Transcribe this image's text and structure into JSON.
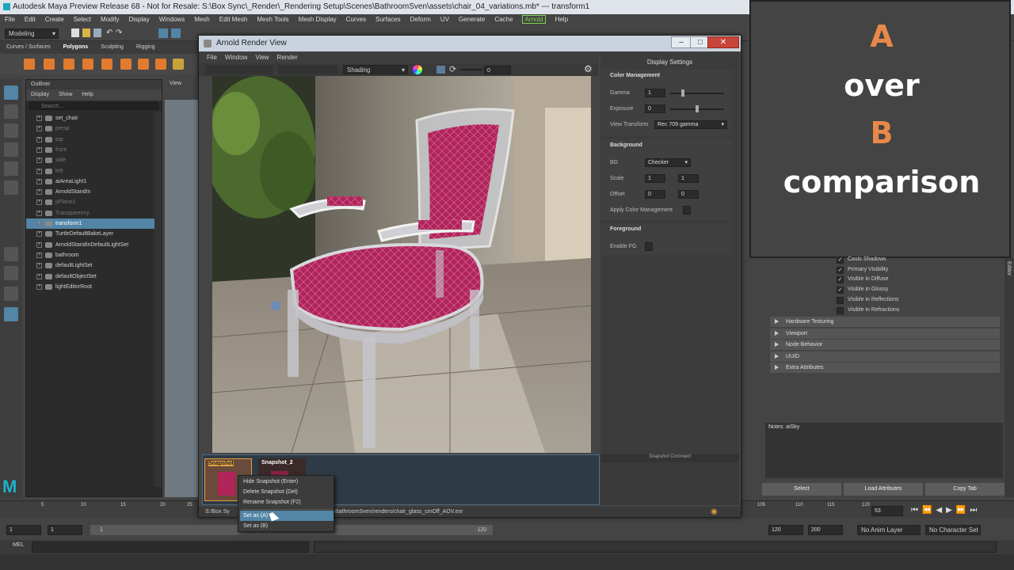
{
  "app": {
    "window_title": "Autodesk Maya Preview Release 68 - Not for Resale: S:\\Box Sync\\_Render\\_Rendering Setup\\Scenes\\BathroomSven\\assets\\chair_04_variations.mb*   ---   transform1"
  },
  "menubar": [
    "File",
    "Edit",
    "Create",
    "Select",
    "Modify",
    "Display",
    "Windows",
    "Mesh",
    "Edit Mesh",
    "Mesh Tools",
    "Mesh Display",
    "Curves",
    "Surfaces",
    "Deform",
    "UV",
    "Generate",
    "Cache",
    "Arnold",
    "Help"
  ],
  "statusline": {
    "mode": "Modeling"
  },
  "shelf": {
    "tabs": [
      "Curves / Surfaces",
      "Polygons",
      "Sculpting",
      "Rigging"
    ],
    "active_tab": "Polygons"
  },
  "outliner": {
    "title": "Outliner",
    "menus": [
      "Display",
      "Show",
      "Help"
    ],
    "search_placeholder": "Search...",
    "items": [
      {
        "label": "set_chair",
        "dim": false,
        "selected": false
      },
      {
        "label": "persp",
        "dim": true,
        "selected": false
      },
      {
        "label": "top",
        "dim": true,
        "selected": false
      },
      {
        "label": "front",
        "dim": true,
        "selected": false
      },
      {
        "label": "side",
        "dim": true,
        "selected": false
      },
      {
        "label": "left",
        "dim": true,
        "selected": false
      },
      {
        "label": "aiAreaLight1",
        "dim": false,
        "selected": false
      },
      {
        "label": "ArnoldStandIn",
        "dim": false,
        "selected": false
      },
      {
        "label": "pPlane1",
        "dim": true,
        "selected": false
      },
      {
        "label": "Transparency",
        "dim": true,
        "selected": false
      },
      {
        "label": "transform1",
        "dim": false,
        "selected": true
      },
      {
        "label": "TurtleDefaultBakeLayer",
        "dim": false,
        "selected": false
      },
      {
        "label": "ArnoldStandInDefaultLightSet",
        "dim": false,
        "selected": false
      },
      {
        "label": "bathroom",
        "dim": false,
        "selected": false
      },
      {
        "label": "defaultLightSet",
        "dim": false,
        "selected": false
      },
      {
        "label": "defaultObjectSet",
        "dim": false,
        "selected": false
      },
      {
        "label": "lightEditorRoot",
        "dim": false,
        "selected": false
      }
    ]
  },
  "viewport": {
    "menu_label": "View"
  },
  "render_view": {
    "title": "Arnold Render View",
    "menus": [
      "File",
      "Window",
      "View",
      "Render"
    ],
    "toolbar": {
      "shading": "Shading",
      "exposure_value": "0"
    },
    "display_settings": {
      "title": "Display Settings",
      "color_management": {
        "heading": "Color Management",
        "gamma_label": "Gamma",
        "gamma_value": "1",
        "exposure_label": "Exposure",
        "exposure_value": "0",
        "view_transform_label": "View Transform",
        "view_transform_value": "Rec 709 gamma"
      },
      "background": {
        "heading": "Background",
        "bg_label": "BG",
        "bg_value": "Checker",
        "scale_label": "Scale",
        "scale_x": "1",
        "scale_y": "1",
        "offset_label": "Offset",
        "offset_x": "0",
        "offset_y": "0",
        "apply_cm_label": "Apply Color Management"
      },
      "foreground": {
        "heading": "Foreground",
        "enable_fg_label": "Enable FG"
      }
    },
    "snapshots": [
      {
        "label": "Snapshot"
      },
      {
        "label": "Snapshot_2"
      }
    ],
    "snapshot_comment_label": "Snapshot Comment",
    "status_left": "S:/Box Sy",
    "status_path": "BathroomSven/renders/chair_glass_cmOff_AOV.exr"
  },
  "context_menu": {
    "items": [
      {
        "label": "Hide Snapshot  (Enter)"
      },
      {
        "label": "Delete Snapshot  (Del)"
      },
      {
        "label": "Rename Snapshot  (F2)"
      },
      {
        "label": "Set as (A)"
      },
      {
        "label": "Set as (B)"
      }
    ]
  },
  "overlay": {
    "line1": "A",
    "line2": "over",
    "line3": "B",
    "line4": "comparison",
    "accent_color": "#e8884a",
    "text_color": "#ffffff"
  },
  "attribute_editor": {
    "checkboxes": [
      {
        "label": "Casts Shadows",
        "checked": true
      },
      {
        "label": "Primary Visibility",
        "checked": true
      },
      {
        "label": "Visible in Diffuse",
        "checked": true
      },
      {
        "label": "Visible in Glossy",
        "checked": true
      },
      {
        "label": "Visible in Reflections",
        "checked": false
      },
      {
        "label": "Visible in Refractions",
        "checked": false
      }
    ],
    "sections": [
      "Hardware Texturing",
      "Viewport",
      "Node Behavior",
      "UUID",
      "Extra Attributes"
    ],
    "notes_label": "Notes: aiSky",
    "buttons": [
      "Select",
      "Load Attributes",
      "Copy Tab"
    ],
    "side_tab": "Editor"
  },
  "timeline": {
    "ticks": [
      "5",
      "10",
      "15",
      "20",
      "25",
      "105",
      "110",
      "115",
      "120"
    ],
    "current_frame": "53"
  },
  "range": {
    "start": "1",
    "start_inner": "1",
    "slider_start": "1",
    "slider_end": "120",
    "end_inner": "120",
    "end": "200",
    "anim_layer": "No Anim Layer",
    "character_set": "No Character Set"
  },
  "cmdline": {
    "label": "MEL"
  }
}
